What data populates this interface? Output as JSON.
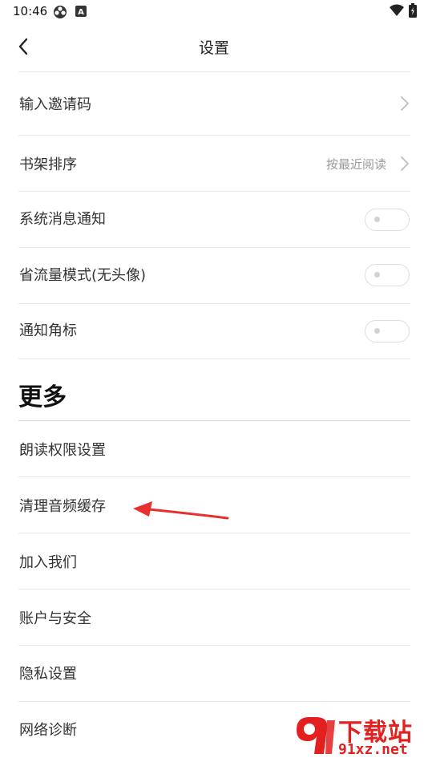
{
  "status_bar": {
    "time": "10:46",
    "icons": [
      "clover-icon",
      "font-a-icon"
    ],
    "right_icons": [
      "wifi-icon",
      "battery-icon"
    ]
  },
  "header": {
    "title": "设置",
    "back_icon": "chevron-left-icon"
  },
  "settings": {
    "invite_code": {
      "label": "输入邀请码"
    },
    "shelf_sort": {
      "label": "书架排序",
      "value": "按最近阅读"
    },
    "system_notify": {
      "label": "系统消息通知",
      "enabled": false
    },
    "data_saver": {
      "label": "省流量模式(无头像)",
      "enabled": false
    },
    "badge_notify": {
      "label": "通知角标",
      "enabled": false
    }
  },
  "more": {
    "title": "更多",
    "items": [
      {
        "label": "朗读权限设置"
      },
      {
        "label": "清理音频缓存"
      },
      {
        "label": "加入我们"
      },
      {
        "label": "账户与安全"
      },
      {
        "label": "隐私设置"
      },
      {
        "label": "网络诊断"
      }
    ]
  },
  "annotation": {
    "color": "#e8302e"
  },
  "watermark": {
    "text_cn": "下载站",
    "text_url": "91xz.net",
    "color": "#e2201f"
  }
}
